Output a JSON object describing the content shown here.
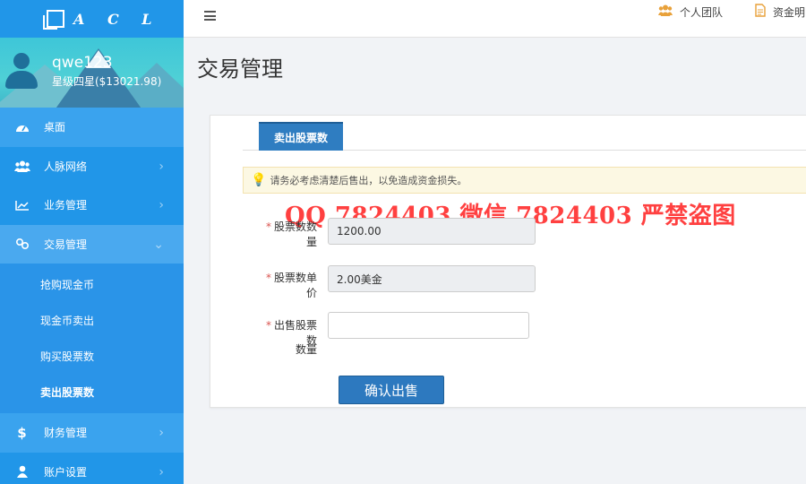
{
  "brand": {
    "logo_text": "A C L"
  },
  "user": {
    "name": "qwe123",
    "level": "星级四星($13021.98)"
  },
  "sidebar": {
    "items": [
      {
        "label": "桌面",
        "icon": "dashboard-icon"
      },
      {
        "label": "人脉网络",
        "icon": "users-icon"
      },
      {
        "label": "业务管理",
        "icon": "chart-line-icon"
      },
      {
        "label": "交易管理",
        "icon": "link-icon"
      },
      {
        "label": "财务管理",
        "icon": "dollar-icon"
      },
      {
        "label": "账户设置",
        "icon": "user-icon"
      }
    ],
    "submenu": [
      {
        "label": "抢购现金币"
      },
      {
        "label": "现金币卖出"
      },
      {
        "label": "购买股票数"
      },
      {
        "label": "卖出股票数"
      }
    ]
  },
  "topbar": {
    "links": [
      {
        "label": "个人团队",
        "icon": "team-icon"
      },
      {
        "label": "资金明",
        "icon": "document-icon"
      }
    ]
  },
  "page": {
    "title": "交易管理"
  },
  "form": {
    "tab_label": "卖出股票数",
    "notice": "请务必考虑清楚后售出，以免造成资金损失。",
    "watermark": "QQ 7824403  微信 7824403 严禁盗图",
    "fields": [
      {
        "label": "股票数数量",
        "value": "1200.00"
      },
      {
        "label": "股票数单价",
        "value": "2.00美金"
      },
      {
        "label": "出售股票数",
        "label2": "数量",
        "value": "",
        "placeholder": ""
      }
    ],
    "required_mark": "*",
    "submit_label": "确认出售"
  },
  "colors": {
    "sidebar": "#2196e8",
    "primary_button": "#2d79bf",
    "required": "#d9534f",
    "watermark": "#ff1f1f"
  }
}
